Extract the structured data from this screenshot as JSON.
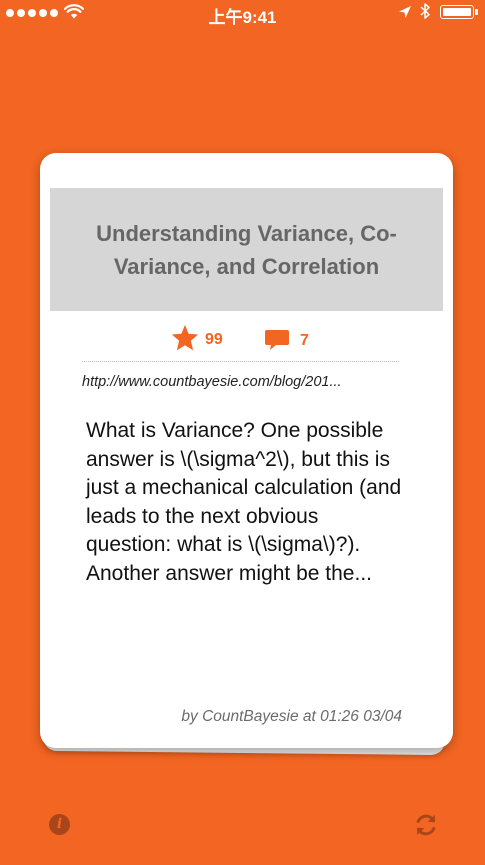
{
  "status_bar": {
    "time": "上午9:41",
    "signal_dots": 5,
    "battery_level": 1.0,
    "icons": [
      "signal-dots-icon",
      "wifi-icon",
      "location-arrow-icon",
      "bluetooth-icon",
      "battery-icon"
    ]
  },
  "card": {
    "title": "Understanding Variance, Co-Variance, and Correlation",
    "stars": "99",
    "comments": "7",
    "url": "http://www.countbayesie.com/blog/201...",
    "excerpt": "What is Variance?  One possible answer is \\(\\sigma^2\\), but this is just a mechanical calculation (and leads to the next obvious question: what is \\(\\sigma\\)?). Another answer might be the...",
    "byline": "by CountBayesie at 01:26 03/04"
  },
  "toolbar": {
    "info_glyph": "i",
    "icons": [
      "info-icon",
      "refresh-icon"
    ]
  },
  "colors": {
    "background": "#F26522",
    "title_band": "#D6D6D6",
    "accent": "#F26522",
    "toolbar_icon": "#A8451A"
  }
}
